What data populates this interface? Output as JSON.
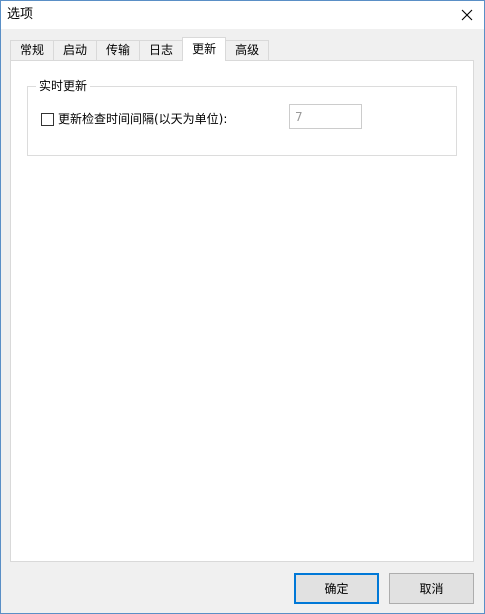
{
  "window": {
    "title": "选项"
  },
  "tabs": [
    {
      "label": "常规"
    },
    {
      "label": "启动"
    },
    {
      "label": "传输"
    },
    {
      "label": "日志"
    },
    {
      "label": "更新",
      "active": true
    },
    {
      "label": "高级"
    }
  ],
  "update_panel": {
    "group_title": "实时更新",
    "check_label": "更新检查时间间隔(以天为单位):",
    "checked": false,
    "interval_value": "7"
  },
  "buttons": {
    "ok_label": "确定",
    "cancel_label": "取消"
  },
  "colors": {
    "accent": "#0078d7",
    "window_border": "#5a8fc6",
    "panel_bg": "#ffffff",
    "dialog_bg": "#f0f0f0"
  },
  "icons": {
    "close": "close-icon"
  }
}
